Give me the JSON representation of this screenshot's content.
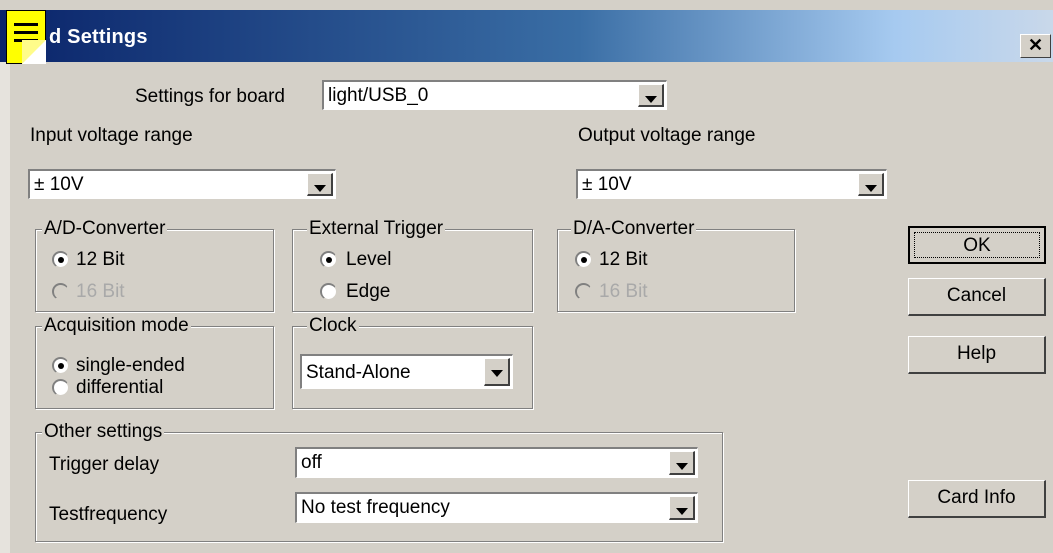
{
  "window": {
    "title": "d Settings",
    "close_glyph": "✕"
  },
  "board": {
    "label": "Settings for board",
    "value": "light/USB_0"
  },
  "input_range": {
    "label": "Input voltage range",
    "value": "± 10V"
  },
  "output_range": {
    "label": "Output voltage range",
    "value": "± 10V"
  },
  "ad_converter": {
    "title": "A/D-Converter",
    "options": [
      {
        "label": "12 Bit",
        "selected": true,
        "enabled": true
      },
      {
        "label": "16 Bit",
        "selected": false,
        "enabled": false
      }
    ]
  },
  "external_trigger": {
    "title": "External Trigger",
    "options": [
      {
        "label": "Level",
        "selected": true
      },
      {
        "label": "Edge",
        "selected": false
      }
    ]
  },
  "da_converter": {
    "title": "D/A-Converter",
    "options": [
      {
        "label": "12 Bit",
        "selected": true,
        "enabled": true
      },
      {
        "label": "16 Bit",
        "selected": false,
        "enabled": false
      }
    ]
  },
  "acquisition_mode": {
    "title": "Acquisition mode",
    "options": [
      {
        "label": "single-ended",
        "selected": true
      },
      {
        "label": "differential",
        "selected": false
      }
    ]
  },
  "clock": {
    "title": "Clock",
    "value": "Stand-Alone"
  },
  "other_settings": {
    "title": "Other settings",
    "trigger_delay": {
      "label": "Trigger delay",
      "value": "off"
    },
    "testfrequency": {
      "label": "Testfrequency",
      "value": "No test frequency"
    }
  },
  "buttons": {
    "ok": "OK",
    "cancel": "Cancel",
    "help": "Help",
    "card_info": "Card Info"
  },
  "colors": {
    "titlebar_start": "#0a246a",
    "titlebar_end": "#a6caf0",
    "dialog_bg": "#d4d0c8",
    "note_icon": "#ffff00"
  }
}
